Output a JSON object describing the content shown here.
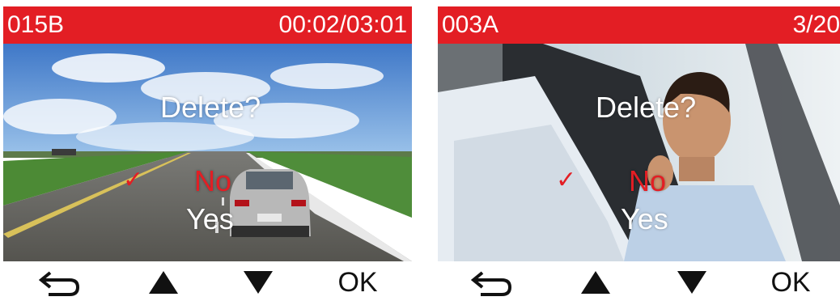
{
  "left_screen": {
    "clip_id": "015B",
    "time_display": "00:02/03:01",
    "prompt": "Delete?",
    "option_no": "No",
    "option_yes": "Yes",
    "check_icon": "✓",
    "buttons": {
      "back_icon": "back-arrow-icon",
      "up_icon": "up-triangle-icon",
      "down_icon": "down-triangle-icon",
      "ok_label": "OK"
    }
  },
  "right_screen": {
    "clip_id": "003A",
    "file_counter": "3/20",
    "prompt": "Delete?",
    "option_no": "No",
    "option_yes": "Yes",
    "check_icon": "✓",
    "buttons": {
      "back_icon": "back-arrow-icon",
      "up_icon": "up-triangle-icon",
      "down_icon": "down-triangle-icon",
      "ok_label": "OK"
    }
  },
  "colors": {
    "title_bar": "#e31e24",
    "selected_option": "#e31e24",
    "text": "#ffffff"
  }
}
